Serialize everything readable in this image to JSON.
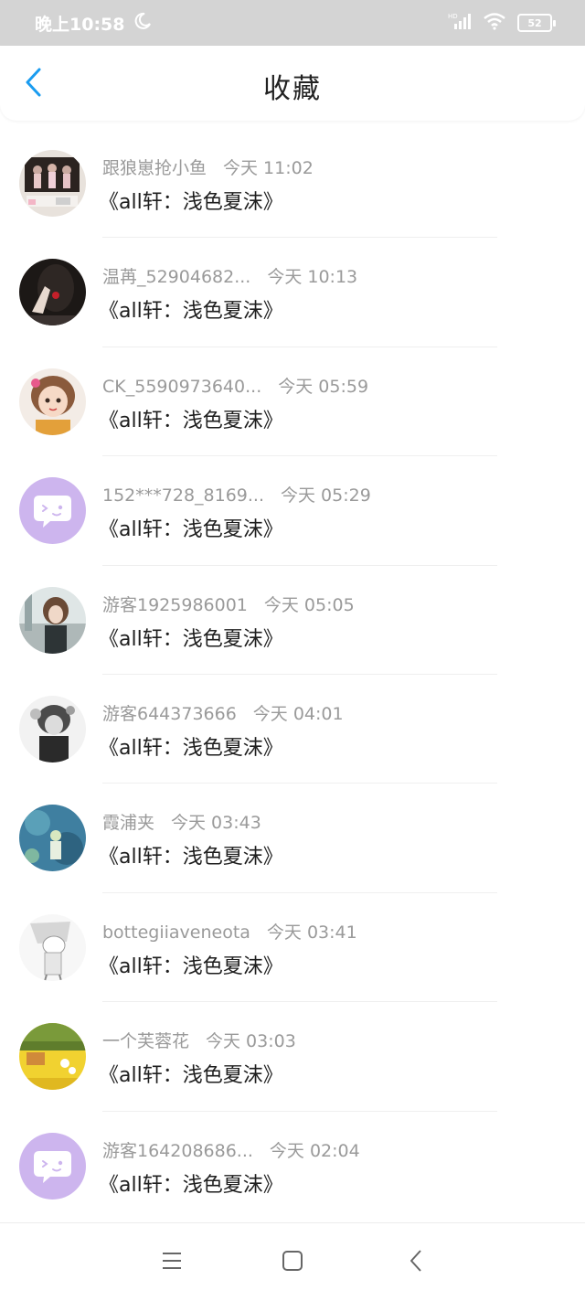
{
  "status_bar": {
    "time": "晚上10:58",
    "battery": "52",
    "hd_label": "HD"
  },
  "header": {
    "title": "收藏"
  },
  "items": [
    {
      "name": "跟狼崽抢小鱼",
      "time": "今天 11:02",
      "content": "《all轩：浅色夏沫》",
      "avatar": "photo"
    },
    {
      "name": "温苒_52904682...",
      "time": "今天 10:13",
      "content": "《all轩：浅色夏沫》",
      "avatar": "photo"
    },
    {
      "name": "CK_5590973640...",
      "time": "今天 05:59",
      "content": "《all轩：浅色夏沫》",
      "avatar": "photo"
    },
    {
      "name": "152***728_8169...",
      "time": "今天 05:29",
      "content": "《all轩：浅色夏沫》",
      "avatar": "default-chat-icon"
    },
    {
      "name": "游客1925986001",
      "time": "今天 05:05",
      "content": "《all轩：浅色夏沫》",
      "avatar": "photo"
    },
    {
      "name": "游客644373666",
      "time": "今天 04:01",
      "content": "《all轩：浅色夏沫》",
      "avatar": "photo"
    },
    {
      "name": "霞浦夹",
      "time": "今天 03:43",
      "content": "《all轩：浅色夏沫》",
      "avatar": "photo"
    },
    {
      "name": "bottegiiaveneota",
      "time": "今天 03:41",
      "content": "《all轩：浅色夏沫》",
      "avatar": "photo"
    },
    {
      "name": "一个芙蓉花",
      "time": "今天 03:03",
      "content": "《all轩：浅色夏沫》",
      "avatar": "photo"
    },
    {
      "name": "游客164208686...",
      "time": "今天 02:04",
      "content": "《all轩：浅色夏沫》",
      "avatar": "default-chat-icon"
    }
  ],
  "colors": {
    "accent": "#1a9cf0",
    "meta_text": "#9a9a9a",
    "default_avatar_bg": "#cdb5ee"
  },
  "nav_bar": {
    "icons": [
      "menu-icon",
      "home-square-icon",
      "back-triangle-icon"
    ]
  }
}
